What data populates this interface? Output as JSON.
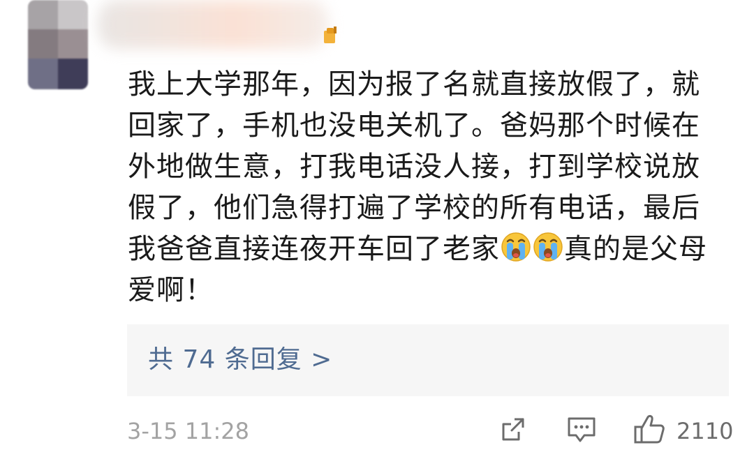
{
  "comment": {
    "line1": "我上大学那年，因为报了名就直接放假了，就",
    "line2": "回家了，手机也没电关机了。爸妈那个时候在",
    "line3": "外地做生意，打我电话没人接，打到学校说放",
    "line4": "假了，他们急得打遍了学校的所有电话，最后",
    "line5_before": "我爸爸直接连夜开车回了老家",
    "line5_after": "真的是父母",
    "line6": "爱啊！",
    "emoji": "crying-face-emoji"
  },
  "replies": {
    "label": "共 74 条回复 >"
  },
  "meta": {
    "timestamp": "3-15 11:28",
    "like_count": "2110",
    "icons": [
      "share-icon",
      "comment-icon",
      "like-icon"
    ]
  },
  "colors": {
    "text": "#1a1a1a",
    "link": "#4f6b91",
    "muted": "#a3a3a3",
    "reply_bg": "#f6f6f6"
  }
}
